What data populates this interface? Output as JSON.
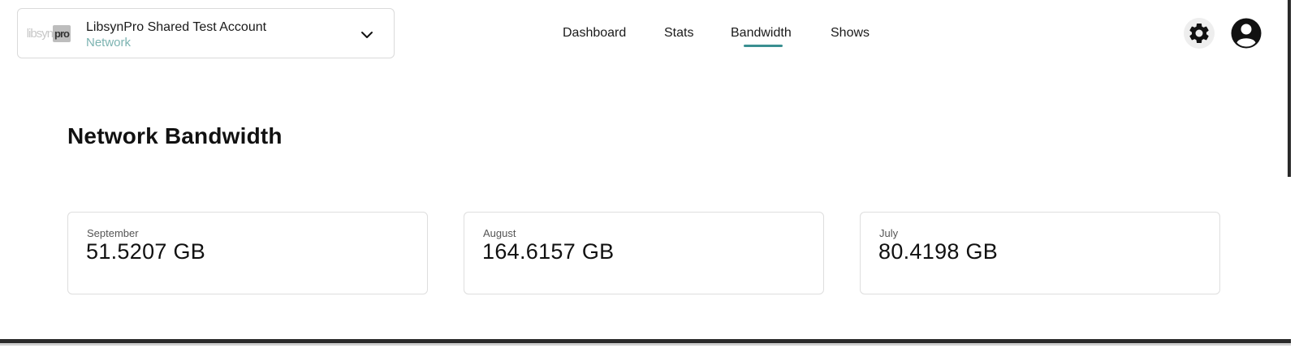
{
  "account": {
    "logo_text_light": "libsyn",
    "logo_text_dark": "pro",
    "name": "LibsynPro Shared Test Account",
    "type": "Network"
  },
  "nav": {
    "items": [
      {
        "label": "Dashboard"
      },
      {
        "label": "Stats"
      },
      {
        "label": "Bandwidth",
        "active": true
      },
      {
        "label": "Shows"
      }
    ]
  },
  "icons": {
    "account_dropdown": "chevron-down-icon",
    "settings": "gear-icon",
    "profile": "user-circle-icon"
  },
  "colors": {
    "accent": "#3a8f91",
    "account_type": "#7cb3b1"
  },
  "page": {
    "title": "Network Bandwidth"
  },
  "bandwidth": {
    "months": [
      {
        "month": "September",
        "value": "51.5207 GB"
      },
      {
        "month": "August",
        "value": "164.6157 GB"
      },
      {
        "month": "July",
        "value": "80.4198 GB"
      }
    ]
  }
}
